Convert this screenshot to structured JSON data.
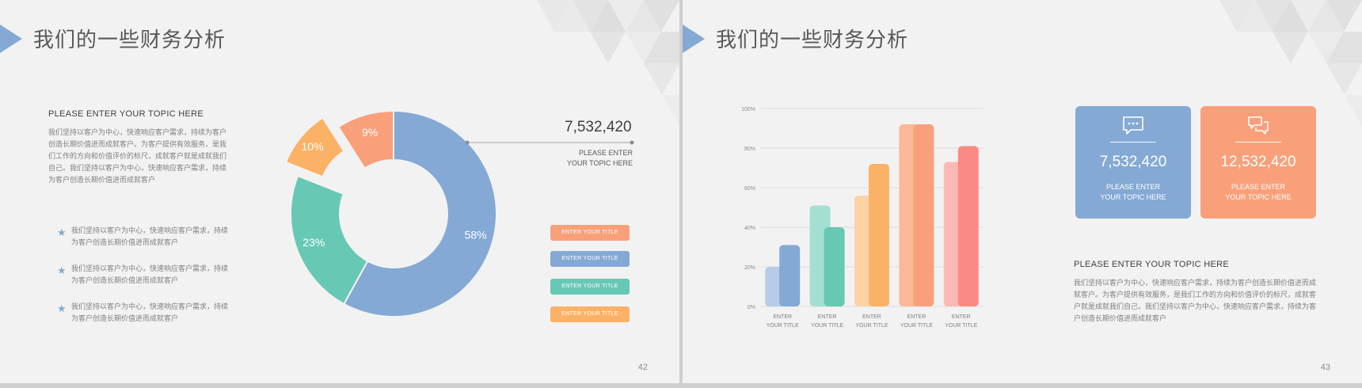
{
  "left_slide": {
    "title": "我们的一些财务分析",
    "page_number": "42",
    "topic": {
      "heading": "PLEASE ENTER YOUR TOPIC HERE",
      "lines": [
        "我们坚持以客户为中心，快速响应客户需求，持续为客户",
        "创造长期价值进而成就客户。为客户提供有效服务，是我",
        "们工作的方向和价值评价的标尺，成就客户就是成就我们",
        "自己。我们坚持以客户为中心，快速响应客户需求，持续",
        "为客户创造长期价值进而成就客户"
      ]
    },
    "bullets": [
      {
        "line1": "我们坚持以客户为中心，快速响应客户需求，持续",
        "line2": "为客户创造长期价值进而成就客户"
      },
      {
        "line1": "我们坚持以客户为中心，快速响应客户需求，持续",
        "line2": "为客户创造长期价值进而成就客户"
      },
      {
        "line1": "我们坚持以客户为中心，快速响应客户需求，持续",
        "line2": "为客户创造长期价值进而成就客户"
      }
    ],
    "callout": {
      "value": "7,532,420",
      "line1": "PLEASE ENTER",
      "line2": "YOUR TOPIC HERE"
    },
    "legend": [
      {
        "label": "ENTER YOUR TITLE",
        "color": "#f9a07a"
      },
      {
        "label": "ENTER YOUR TITLE",
        "color": "#84a9d4"
      },
      {
        "label": "ENTER YOUR TITLE",
        "color": "#67c9b3"
      },
      {
        "label": "ENTER YOUR TITLE",
        "color": "#fbb266"
      }
    ]
  },
  "right_slide": {
    "title": "我们的一些财务分析",
    "page_number": "43",
    "cards": [
      {
        "value": "7,532,420",
        "line1": "PLEASE ENTER",
        "line2": "YOUR TOPIC HERE",
        "color": "#84a9d4",
        "icon": "chat-bubble-icon"
      },
      {
        "value": "12,532,420",
        "line1": "PLEASE ENTER",
        "line2": "YOUR TOPIC HERE",
        "color": "#f9a07a",
        "icon": "conversation-icon"
      }
    ],
    "topic": {
      "heading": "PLEASE ENTER YOUR TOPIC HERE",
      "lines": [
        "我们坚持以客户为中心，快速响应客户需求，持续为客户创造长期价值进而成",
        "就客户。为客户提供有效服务，是我们工作的方向和价值评价的标尺，成就客",
        "户就是成就我们自己。我们坚持以客户为中心，快速响应客户需求，持续为客",
        "户创造长期价值进而成就客户"
      ]
    }
  },
  "chart_data": [
    {
      "type": "pie",
      "variant": "donut",
      "values": [
        58,
        23,
        10,
        9
      ],
      "labels": [
        "58%",
        "23%",
        "10%",
        "9%"
      ],
      "colors": [
        "#84a9d4",
        "#67c9b3",
        "#fbb266",
        "#f9a07a"
      ],
      "exploded": [
        false,
        false,
        true,
        false
      ]
    },
    {
      "type": "bar",
      "categories": [
        {
          "line1": "ENTER",
          "line2": "YOUR TITLE"
        },
        {
          "line1": "ENTER",
          "line2": "YOUR TITLE"
        },
        {
          "line1": "ENTER",
          "line2": "YOUR TITLE"
        },
        {
          "line1": "ENTER",
          "line2": "YOUR TITLE"
        },
        {
          "line1": "ENTER",
          "line2": "YOUR TITLE"
        }
      ],
      "series": [
        {
          "values": [
            20,
            51,
            56,
            92,
            73
          ]
        },
        {
          "values": [
            31,
            40,
            72,
            92,
            81
          ]
        }
      ],
      "colors_back": [
        "#b6cce8",
        "#a3e0d1",
        "#fdd3a4",
        "#fbb899",
        "#fdbab5"
      ],
      "colors_front": [
        "#84a9d4",
        "#67c9b3",
        "#fbb266",
        "#f9a07a",
        "#fb8a84"
      ],
      "yticks": [
        "0%",
        "20%",
        "40%",
        "60%",
        "80%",
        "100%"
      ],
      "ylim": [
        0,
        100
      ],
      "grid": true
    }
  ]
}
